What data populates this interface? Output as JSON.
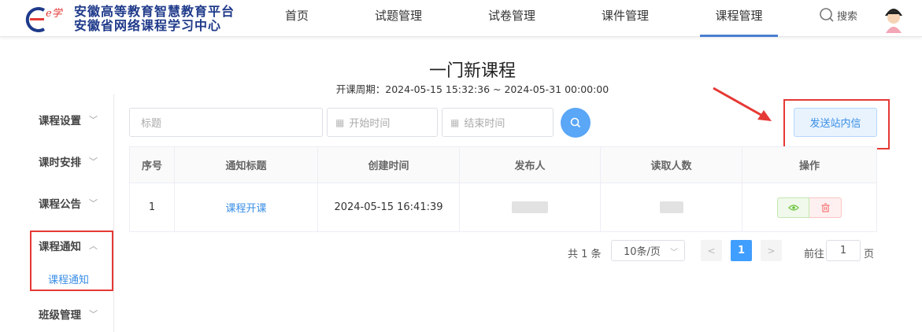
{
  "header": {
    "logo_title_1": "安徽高等教育智慧教育平台",
    "logo_title_2": "安徽省网络课程学习中心",
    "nav": [
      "首页",
      "试题管理",
      "试卷管理",
      "课件管理",
      "课程管理"
    ],
    "active_nav": "课程管理",
    "search_label": "搜索"
  },
  "course": {
    "title": "一门新课程",
    "period": "开课周期：2024-05-15 15:32:36 ~ 2024-05-31 00:00:00"
  },
  "sidebar": {
    "items": [
      "课程设置",
      "课时安排",
      "课程公告",
      "课程通知",
      "班级管理"
    ],
    "active_sub": "课程通知"
  },
  "filters": {
    "title_placeholder": "标题",
    "start_placeholder": "开始时间",
    "end_placeholder": "结束时间"
  },
  "send_button": "发送站内信",
  "table": {
    "headers": [
      "序号",
      "通知标题",
      "创建时间",
      "发布人",
      "读取人数",
      "操作"
    ],
    "rows": [
      {
        "index": "1",
        "title": "课程开课",
        "created": "2024-05-15 16:41:39"
      }
    ]
  },
  "pagination": {
    "total": "共 1 条",
    "page_size": "10条/页",
    "current": "1",
    "goto_prefix": "前往",
    "goto_value": "1",
    "goto_suffix": "页"
  },
  "colors": {
    "accent": "#409eff",
    "highlight_red": "#e53935",
    "nav_active": "#4a7fd1"
  }
}
